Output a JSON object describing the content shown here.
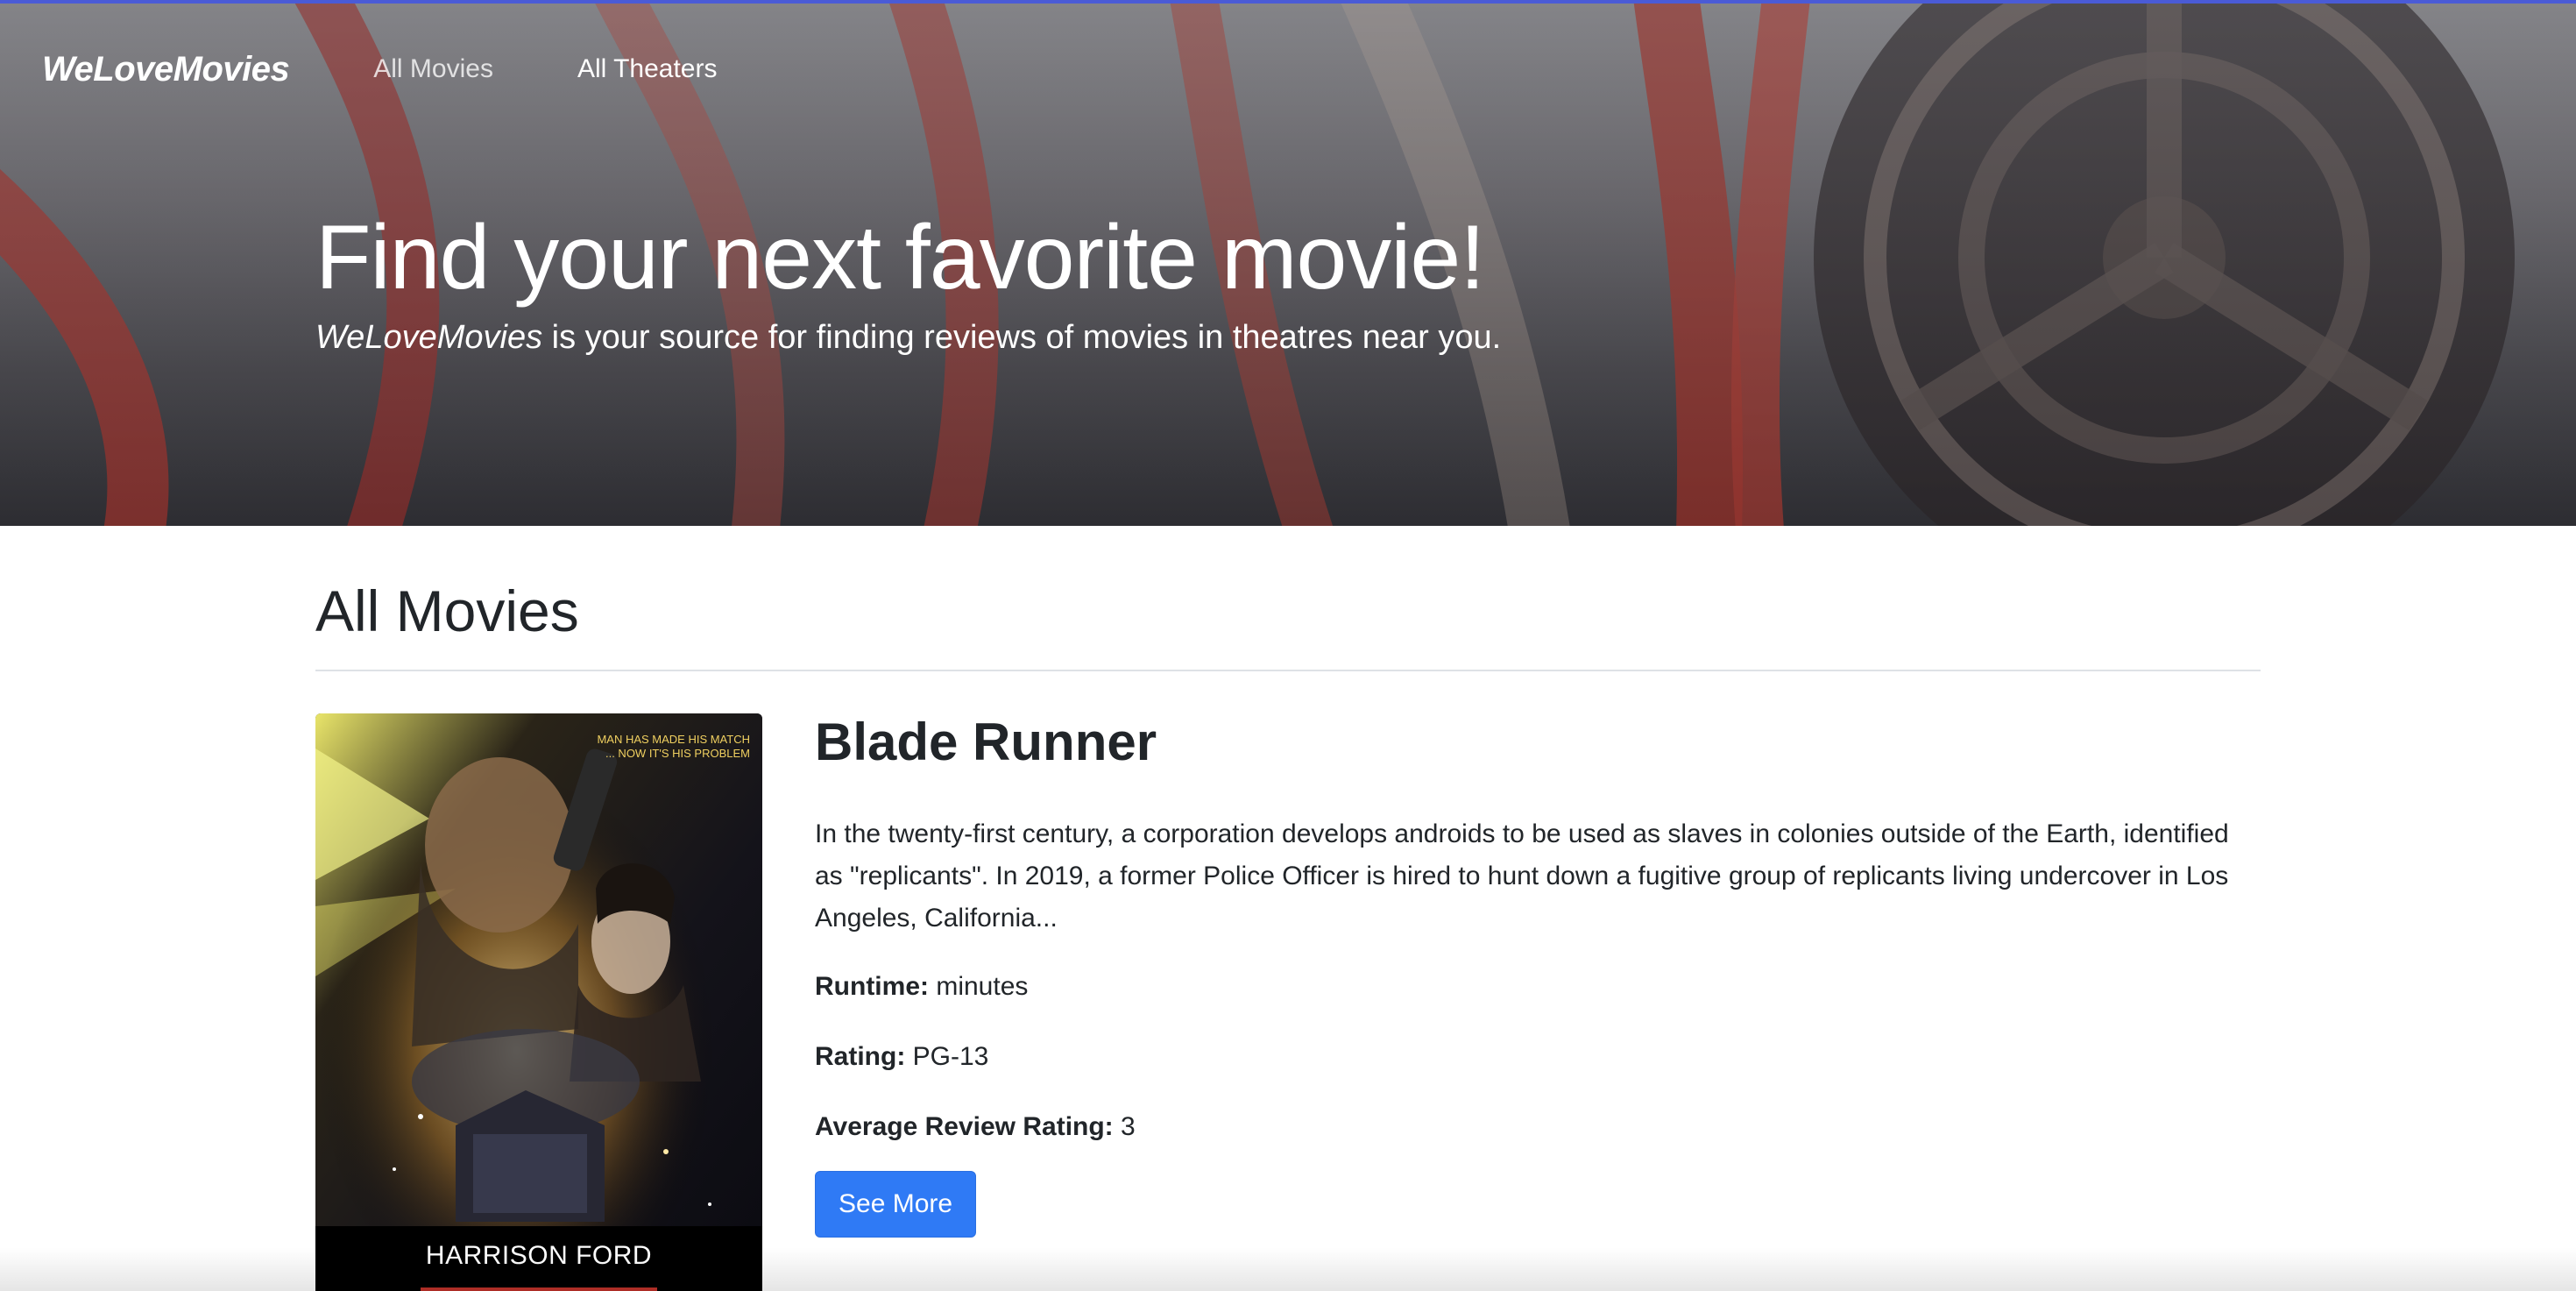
{
  "navbar": {
    "brand": "WeLoveMovies",
    "links": [
      {
        "label": "All Movies",
        "active": false
      },
      {
        "label": "All Theaters",
        "active": true
      }
    ]
  },
  "hero": {
    "title": "Find your next favorite movie!",
    "subtitle_brand": "WeLoveMovies",
    "subtitle_rest": " is your source for finding reviews of movies in theatres near you."
  },
  "main": {
    "section_title": "All Movies",
    "movies": [
      {
        "title": "Blade Runner",
        "description": "In the twenty-first century, a corporation develops androids to be used as slaves in colonies outside of the Earth, identified as \"replicants\". In 2019, a former Police Officer is hired to hunt down a fugitive group of replicants living undercover in Los Angeles, California...",
        "runtime_label": "Runtime:",
        "runtime_value": " minutes",
        "rating_label": "Rating:",
        "rating_value": " PG-13",
        "avg_rating_label": "Average Review Rating:",
        "avg_rating_value": " 3",
        "button_label": "See More",
        "poster": {
          "tagline_line1": "MAN HAS MADE HIS MATCH",
          "tagline_line2": "... NOW IT'S HIS PROBLEM",
          "credit": "HARRISON FORD"
        }
      }
    ]
  },
  "colors": {
    "accent": "#2f7af5",
    "top_border": "#4a5bd6",
    "text": "#212529"
  }
}
